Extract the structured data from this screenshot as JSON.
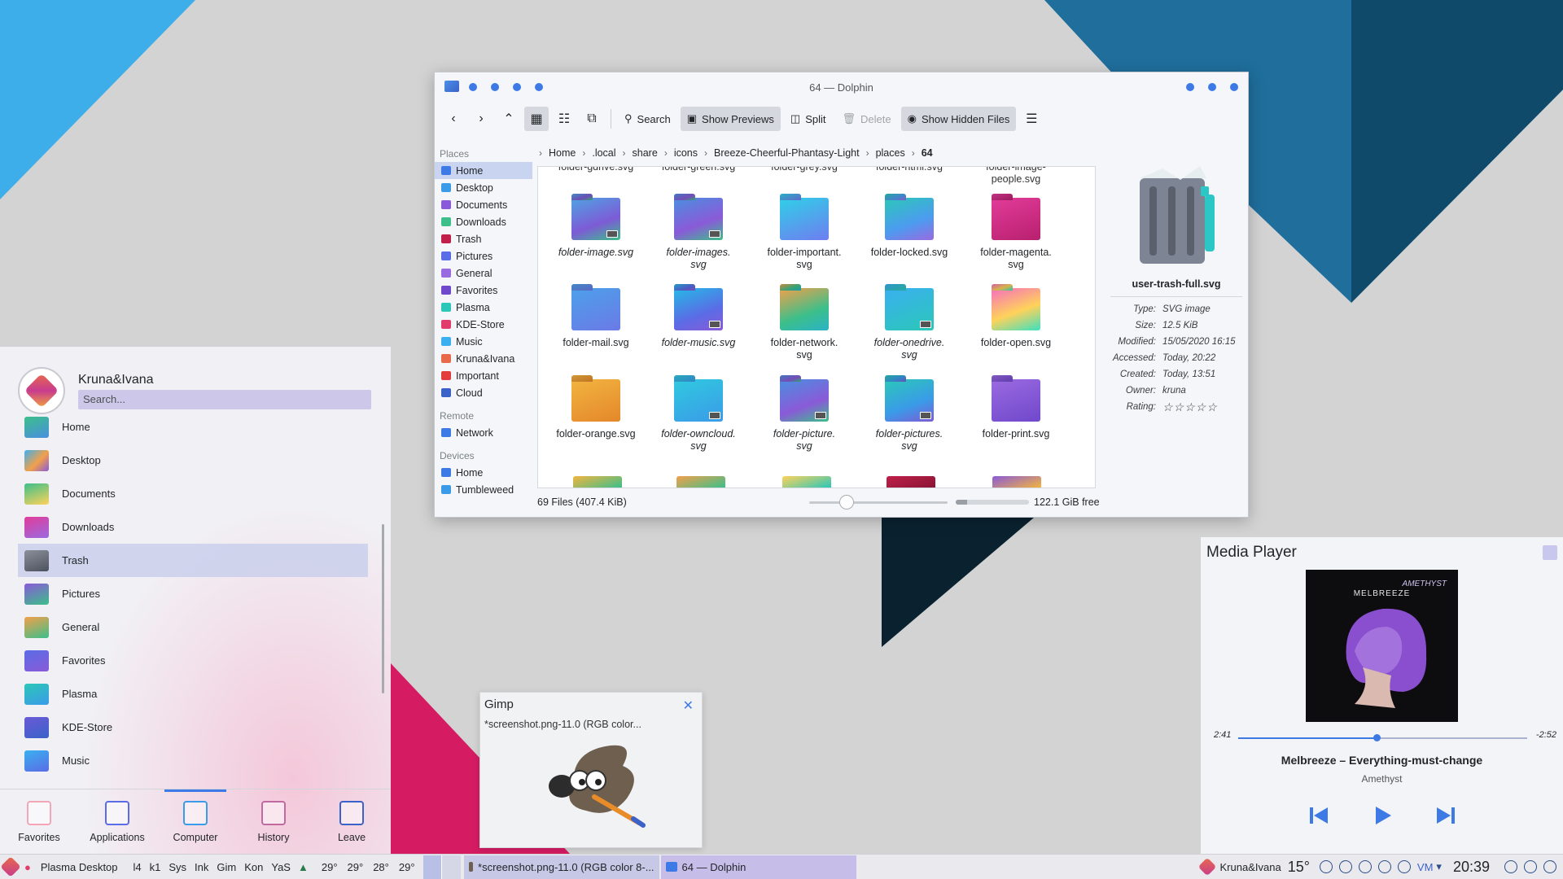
{
  "colors": {
    "accent": "#3d7ae6",
    "selection": "#c8d4f0",
    "panel": "#e9e9ee"
  },
  "dolphin": {
    "title": "64 — Dolphin",
    "toolbar": {
      "back_icon": "chevron-left-icon",
      "forward_icon": "chevron-right-icon",
      "up_icon": "chevron-up-icon",
      "search": "Search",
      "show_previews": "Show Previews",
      "split": "Split",
      "delete": "Delete",
      "show_hidden": "Show Hidden Files"
    },
    "places_heading": "Places",
    "places": [
      "Home",
      "Desktop",
      "Documents",
      "Downloads",
      "Trash",
      "Pictures",
      "General",
      "Favorites",
      "Plasma",
      "KDE-Store",
      "Music",
      "Kruna&Ivana",
      "Important",
      "Cloud"
    ],
    "remote_heading": "Remote",
    "remote": [
      "Network"
    ],
    "devices_heading": "Devices",
    "devices": [
      "Home",
      "Tumbleweed"
    ],
    "breadcrumb": [
      "Home",
      ".local",
      "share",
      "icons",
      "Breeze-Cheerful-Phantasy-Light",
      "places",
      "64"
    ],
    "cutoff_row": [
      "folder-gdrive.svg",
      "folder-green.svg",
      "folder-grey.svg",
      "folder-html.svg",
      "folder-image-"
    ],
    "cutoff_row_line2": "people.svg",
    "files": [
      {
        "l1": "folder-image.svg",
        "l2": "",
        "italic": true,
        "color": "linear-gradient(160deg,#4fa3e3,#7d5bd6 60%,#3cbf8a)"
      },
      {
        "l1": "folder-images.",
        "l2": "svg",
        "italic": true,
        "color": "linear-gradient(160deg,#4a8fe0,#8a5ad8 60%,#3cbf8a)"
      },
      {
        "l1": "folder-important.",
        "l2": "svg",
        "italic": false,
        "color": "linear-gradient(160deg,#2fd0e8,#6f7df0)"
      },
      {
        "l1": "folder-locked.svg",
        "l2": "",
        "italic": false,
        "color": "linear-gradient(160deg,#2bc7b8,#4d9bf0 60%,#9a6ae0)"
      },
      {
        "l1": "folder-magenta.",
        "l2": "svg",
        "italic": false,
        "color": "linear-gradient(160deg,#e23c9a,#b8206e)"
      },
      {
        "l1": "folder-mail.svg",
        "l2": "",
        "italic": false,
        "color": "linear-gradient(160deg,#4da0ea,#6b7ae6)"
      },
      {
        "l1": "folder-music.svg",
        "l2": "",
        "italic": true,
        "color": "linear-gradient(160deg,#25b9e6,#5a6ce6 60%,#8a5ad8)"
      },
      {
        "l1": "folder-network.",
        "l2": "svg",
        "italic": false,
        "color": "linear-gradient(160deg,#f2a04a,#3cbf8a 60%,#2bb3c7)"
      },
      {
        "l1": "folder-onedrive.",
        "l2": "svg",
        "italic": true,
        "color": "linear-gradient(160deg,#3ab0f0,#2bc7b8)"
      },
      {
        "l1": "folder-open.svg",
        "l2": "",
        "italic": false,
        "color": "linear-gradient(160deg,#f56fc0,#ffd25a 55%,#3be0c0)"
      },
      {
        "l1": "folder-orange.svg",
        "l2": "",
        "italic": false,
        "color": "linear-gradient(160deg,#f2b440,#e4872a)"
      },
      {
        "l1": "folder-owncloud.",
        "l2": "svg",
        "italic": true,
        "color": "linear-gradient(160deg,#30c9e0,#3a9be8)"
      },
      {
        "l1": "folder-picture.",
        "l2": "svg",
        "italic": true,
        "color": "linear-gradient(160deg,#4a8fe0,#8a5ad8 60%,#3cbf8a)"
      },
      {
        "l1": "folder-pictures.",
        "l2": "svg",
        "italic": true,
        "color": "linear-gradient(160deg,#2bc7b8,#3a9be8 60%,#7d5bd6)"
      },
      {
        "l1": "folder-print.svg",
        "l2": "",
        "italic": false,
        "color": "linear-gradient(160deg,#9a6ae0,#7048cc)"
      }
    ],
    "info": {
      "filename": "user-trash-full.svg",
      "rows": [
        {
          "k": "Type:",
          "v": "SVG image"
        },
        {
          "k": "Size:",
          "v": "12.5 KiB"
        },
        {
          "k": "Modified:",
          "v": "15/05/2020 16:15"
        },
        {
          "k": "Accessed:",
          "v": "Today, 20:22"
        },
        {
          "k": "Created:",
          "v": "Today, 13:51"
        },
        {
          "k": "Owner:",
          "v": "kruna"
        }
      ],
      "rating_label": "Rating:",
      "rating": "☆☆☆☆☆",
      "rating_value": 0
    },
    "status": {
      "files": "69 Files (407.4 KiB)",
      "free": "122.1 GiB free",
      "used_fraction": 0.15
    }
  },
  "launcher": {
    "user": "Kruna&Ivana",
    "search_placeholder": "Search...",
    "apps": [
      {
        "label": "Home",
        "color": "linear-gradient(160deg,#3cbf8a,#4a8fe0)"
      },
      {
        "label": "Desktop",
        "color": "linear-gradient(135deg,#3ab0f0,#f2a04a 55%,#8a5ad8)"
      },
      {
        "label": "Documents",
        "color": "linear-gradient(160deg,#3cbf8a,#ffd25a)"
      },
      {
        "label": "Downloads",
        "color": "linear-gradient(160deg,#e23c9a,#9a6ae0)"
      },
      {
        "label": "Trash",
        "color": "linear-gradient(160deg,#8b8f99,#4e5260)"
      },
      {
        "label": "Pictures",
        "color": "linear-gradient(160deg,#8a5ad8,#3cbf8a)"
      },
      {
        "label": "General",
        "color": "linear-gradient(160deg,#f2a04a,#3cbf8a)"
      },
      {
        "label": "Favorites",
        "color": "linear-gradient(160deg,#5a6ce6,#8a5ad8)"
      },
      {
        "label": "Plasma",
        "color": "linear-gradient(160deg,#2bc7b8,#3a9be8)"
      },
      {
        "label": "KDE-Store",
        "color": "linear-gradient(160deg,#6b5ad6,#3a62c9)"
      },
      {
        "label": "Music",
        "color": "linear-gradient(160deg,#3ab0f0,#5a6ce6)"
      }
    ],
    "tabs": [
      {
        "label": "Favorites",
        "icon": "heart-icon",
        "color": "#f2a6b8"
      },
      {
        "label": "Applications",
        "icon": "grid-icon",
        "color": "#5a6ce6"
      },
      {
        "label": "Computer",
        "icon": "monitor-icon",
        "color": "#3a9be8"
      },
      {
        "label": "History",
        "icon": "book-icon",
        "color": "#c06aa0"
      },
      {
        "label": "Leave",
        "icon": "leave-icon",
        "color": "#3a62c9"
      }
    ]
  },
  "gimp": {
    "title": "Gimp",
    "subtitle": "*screenshot.png-11.0 (RGB color..."
  },
  "media": {
    "title": "Media Player",
    "cover_brand": "MELBREEZE",
    "cover_sub": "AMETHYST",
    "elapsed": "2:41",
    "remaining": "-2:52",
    "progress": 0.48,
    "song": "Melbreeze – Everything-must-change",
    "artist": "Amethyst"
  },
  "panel": {
    "activity": "Plasma Desktop",
    "quick": [
      "l4",
      "k1",
      "Sys",
      "Ink",
      "Gim",
      "Kon",
      "YaS"
    ],
    "temps": [
      "29°",
      "29°",
      "28°",
      "29°"
    ],
    "tasks": [
      {
        "label": "*screenshot.png-11.0 (RGB color 8-...",
        "active": false
      },
      {
        "label": "64 — Dolphin",
        "active": true
      }
    ],
    "user": "Kruna&Ivana",
    "weather": "15°",
    "clock": "20:39"
  }
}
